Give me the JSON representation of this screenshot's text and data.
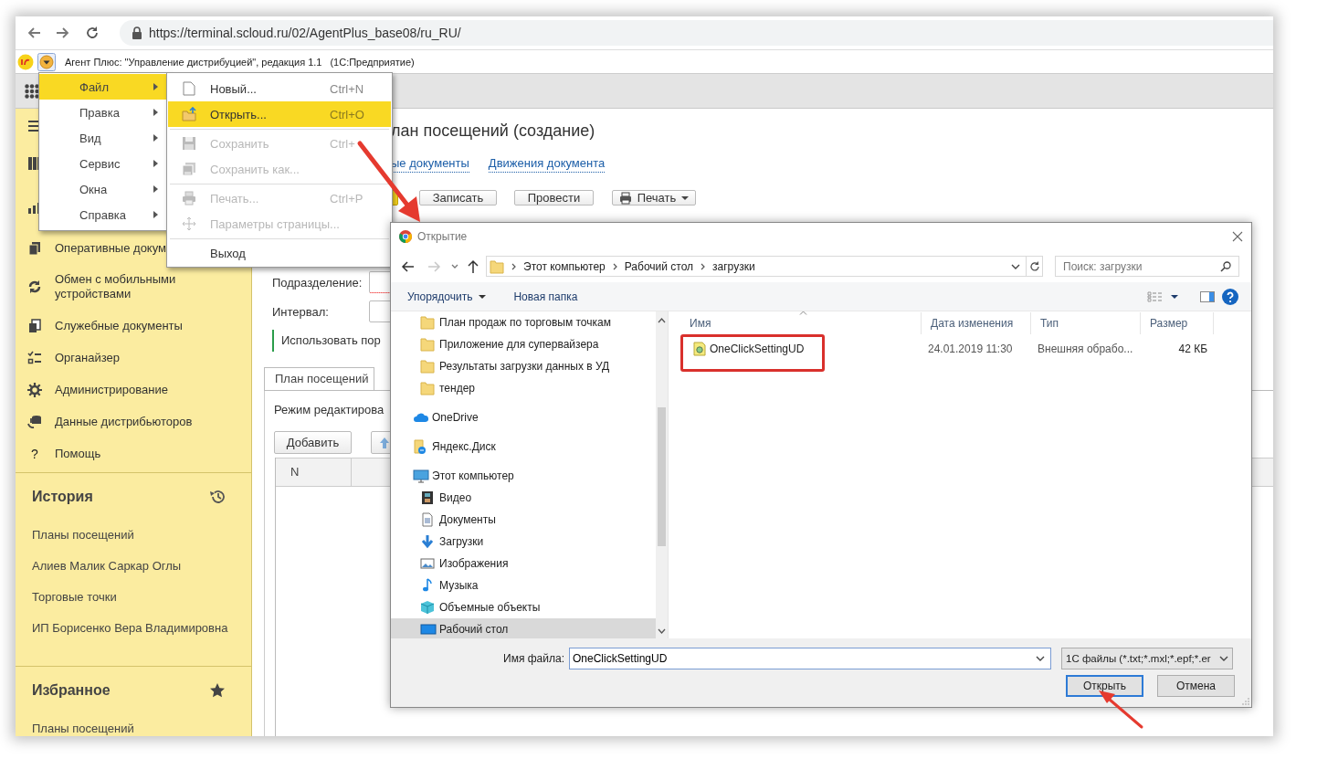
{
  "browser": {
    "url": "https://terminal.scloud.ru/02/AgentPlus_base08/ru_RU/"
  },
  "app_title": {
    "title": "Агент Плюс: \"Управление дистрибуцией\", редакция 1.1",
    "platform": "(1С:Предприятие)"
  },
  "sidebar": {
    "items": [
      {
        "label": "Оперативные докум"
      },
      {
        "label": "Обмен с мобильными устройствами"
      },
      {
        "label": "Служебные документы"
      },
      {
        "label": "Органайзер"
      },
      {
        "label": "Администрирование"
      },
      {
        "label": "Данные дистрибьюторов"
      },
      {
        "label": "Помощь",
        "glyph": "?"
      }
    ],
    "history": {
      "title": "История",
      "items": [
        "Планы посещений",
        "Алиев Малик Саркар Оглы",
        "Торговые точки",
        "ИП Борисенко Вера Владимировна"
      ]
    },
    "favorites": {
      "title": "Избранное",
      "items": [
        "Планы посещений"
      ]
    }
  },
  "form": {
    "title": "лан посещений (создание)",
    "links": [
      "ые документы",
      "Движения документа"
    ],
    "buttons": [
      {
        "kind": "primary"
      },
      {
        "label": "Записать",
        "kind": "plain"
      },
      {
        "label": "Провести",
        "kind": "plain"
      },
      {
        "label": "Печать",
        "kind": "print"
      }
    ],
    "fields": [
      {
        "label": "Подразделение:"
      },
      {
        "label": "Интервал:"
      }
    ],
    "option": "Использовать пор",
    "tabs": [
      {
        "label": "План посещений",
        "selected": true
      }
    ],
    "mode_text": "Режим редактирова",
    "table_buttons": [
      "Добавить"
    ],
    "table": {
      "columns": [
        "N"
      ]
    }
  },
  "menu": {
    "items": [
      {
        "label": "Файл",
        "selected": true
      },
      {
        "label": "Правка",
        "selected": false
      },
      {
        "label": "Вид",
        "selected": false
      },
      {
        "label": "Сервис",
        "selected": false
      },
      {
        "label": "Окна",
        "selected": false
      },
      {
        "label": "Справка",
        "selected": false
      }
    ],
    "submenu": [
      {
        "kind": "item",
        "label": "Новый...",
        "shortcut": "Ctrl+N",
        "selected": false,
        "disabled": false
      },
      {
        "kind": "item",
        "label": "Открыть...",
        "shortcut": "Ctrl+O",
        "selected": true,
        "disabled": false
      },
      {
        "kind": "separator"
      },
      {
        "kind": "item",
        "label": "Сохранить",
        "shortcut": "Ctrl+",
        "selected": false,
        "disabled": true
      },
      {
        "kind": "item",
        "label": "Сохранить как...",
        "selected": false,
        "disabled": true
      },
      {
        "kind": "separator"
      },
      {
        "kind": "item",
        "label": "Печать...",
        "shortcut": "Ctrl+P",
        "selected": false,
        "disabled": true
      },
      {
        "kind": "item",
        "label": "Параметры страницы...",
        "selected": false,
        "disabled": true
      },
      {
        "kind": "separator"
      },
      {
        "kind": "item",
        "label": "Выход",
        "selected": false,
        "disabled": false
      }
    ]
  },
  "dialog": {
    "title": "Открытие",
    "path": [
      "Этот компьютер",
      "Рабочий стол",
      "загрузки"
    ],
    "search": {
      "placeholder": "Поиск: загрузки"
    },
    "toolbar": [
      {
        "label": "Упорядочить",
        "kind": "dropdown"
      },
      {
        "label": "Новая папка",
        "kind": "plain"
      }
    ],
    "nav": [
      {
        "children": [
          {
            "label": "План продаж по торговым точкам",
            "selected": false
          },
          {
            "label": "Приложение для супервайзера",
            "selected": false
          },
          {
            "label": "Результаты загрузки данных в УД",
            "selected": false
          },
          {
            "label": "тендер",
            "selected": false
          }
        ]
      },
      {
        "label": "OneDrive",
        "selected": false
      },
      {
        "label": "Яндекс.Диск",
        "selected": false
      },
      {
        "label": "Этот компьютер",
        "selected": false,
        "children": [
          {
            "label": "Видео",
            "selected": false
          },
          {
            "label": "Документы",
            "selected": false
          },
          {
            "label": "Загрузки",
            "selected": false
          },
          {
            "label": "Изображения",
            "selected": false
          },
          {
            "label": "Музыка",
            "selected": false
          },
          {
            "label": "Объемные объекты",
            "selected": false
          },
          {
            "label": "Рабочий стол",
            "selected": true
          }
        ]
      }
    ],
    "columns": [
      "Имя",
      "Дата изменения",
      "Тип",
      "Размер"
    ],
    "files": [
      {
        "name": "OneClickSettingUD",
        "date": "24.01.2019 11:30",
        "type": "Внешняя обрабо...",
        "size": "42 КБ"
      }
    ],
    "filename_label": "Имя файла:",
    "filename": "OneClickSettingUD",
    "filter": "1С файлы (*.txt;*.mxl;*.epf;*.er",
    "buttons": [
      {
        "label": "Открыть",
        "default": true
      },
      {
        "label": "Отмена",
        "default": false
      }
    ]
  }
}
